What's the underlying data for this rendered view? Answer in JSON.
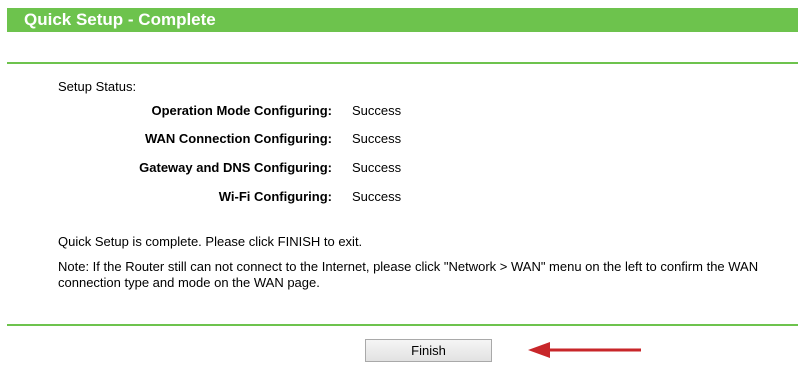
{
  "header": {
    "title": "Quick Setup - Complete"
  },
  "status": {
    "heading": "Setup Status:",
    "rows": [
      {
        "label": "Operation Mode Configuring:",
        "value": "Success"
      },
      {
        "label": "WAN Connection Configuring:",
        "value": "Success"
      },
      {
        "label": "Gateway and DNS Configuring:",
        "value": "Success"
      },
      {
        "label": "Wi-Fi Configuring:",
        "value": "Success"
      }
    ]
  },
  "messages": {
    "complete": "Quick Setup is complete. Please click FINISH to exit.",
    "note": "Note: If the Router still can not connect to the Internet, please click \"Network > WAN\" menu on the left to confirm the WAN connection type and mode on the WAN page."
  },
  "actions": {
    "finish_label": "Finish"
  },
  "colors": {
    "accent_green": "#6dc34d",
    "arrow_red": "#c8262a"
  },
  "icons": {
    "pointer": "arrow-left-icon"
  }
}
